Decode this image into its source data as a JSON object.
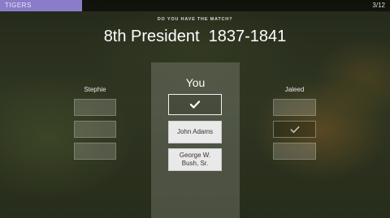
{
  "header": {
    "title": "TIGERS",
    "counter": "3/12",
    "progress": 0.21,
    "accent": "#8a7cc9"
  },
  "prompt": "DO YOU HAVE THE MATCH?",
  "question": "8th President  1837-1841",
  "players": {
    "left": {
      "name": "Stephie",
      "checked_index": -1
    },
    "center": {
      "name": "You"
    },
    "right": {
      "name": "Jaleed",
      "checked_index": 1
    }
  },
  "answers": [
    {
      "label": "John Adams"
    },
    {
      "label": "George W. Bush, Sr."
    }
  ],
  "icons": {
    "check": "check-icon"
  }
}
